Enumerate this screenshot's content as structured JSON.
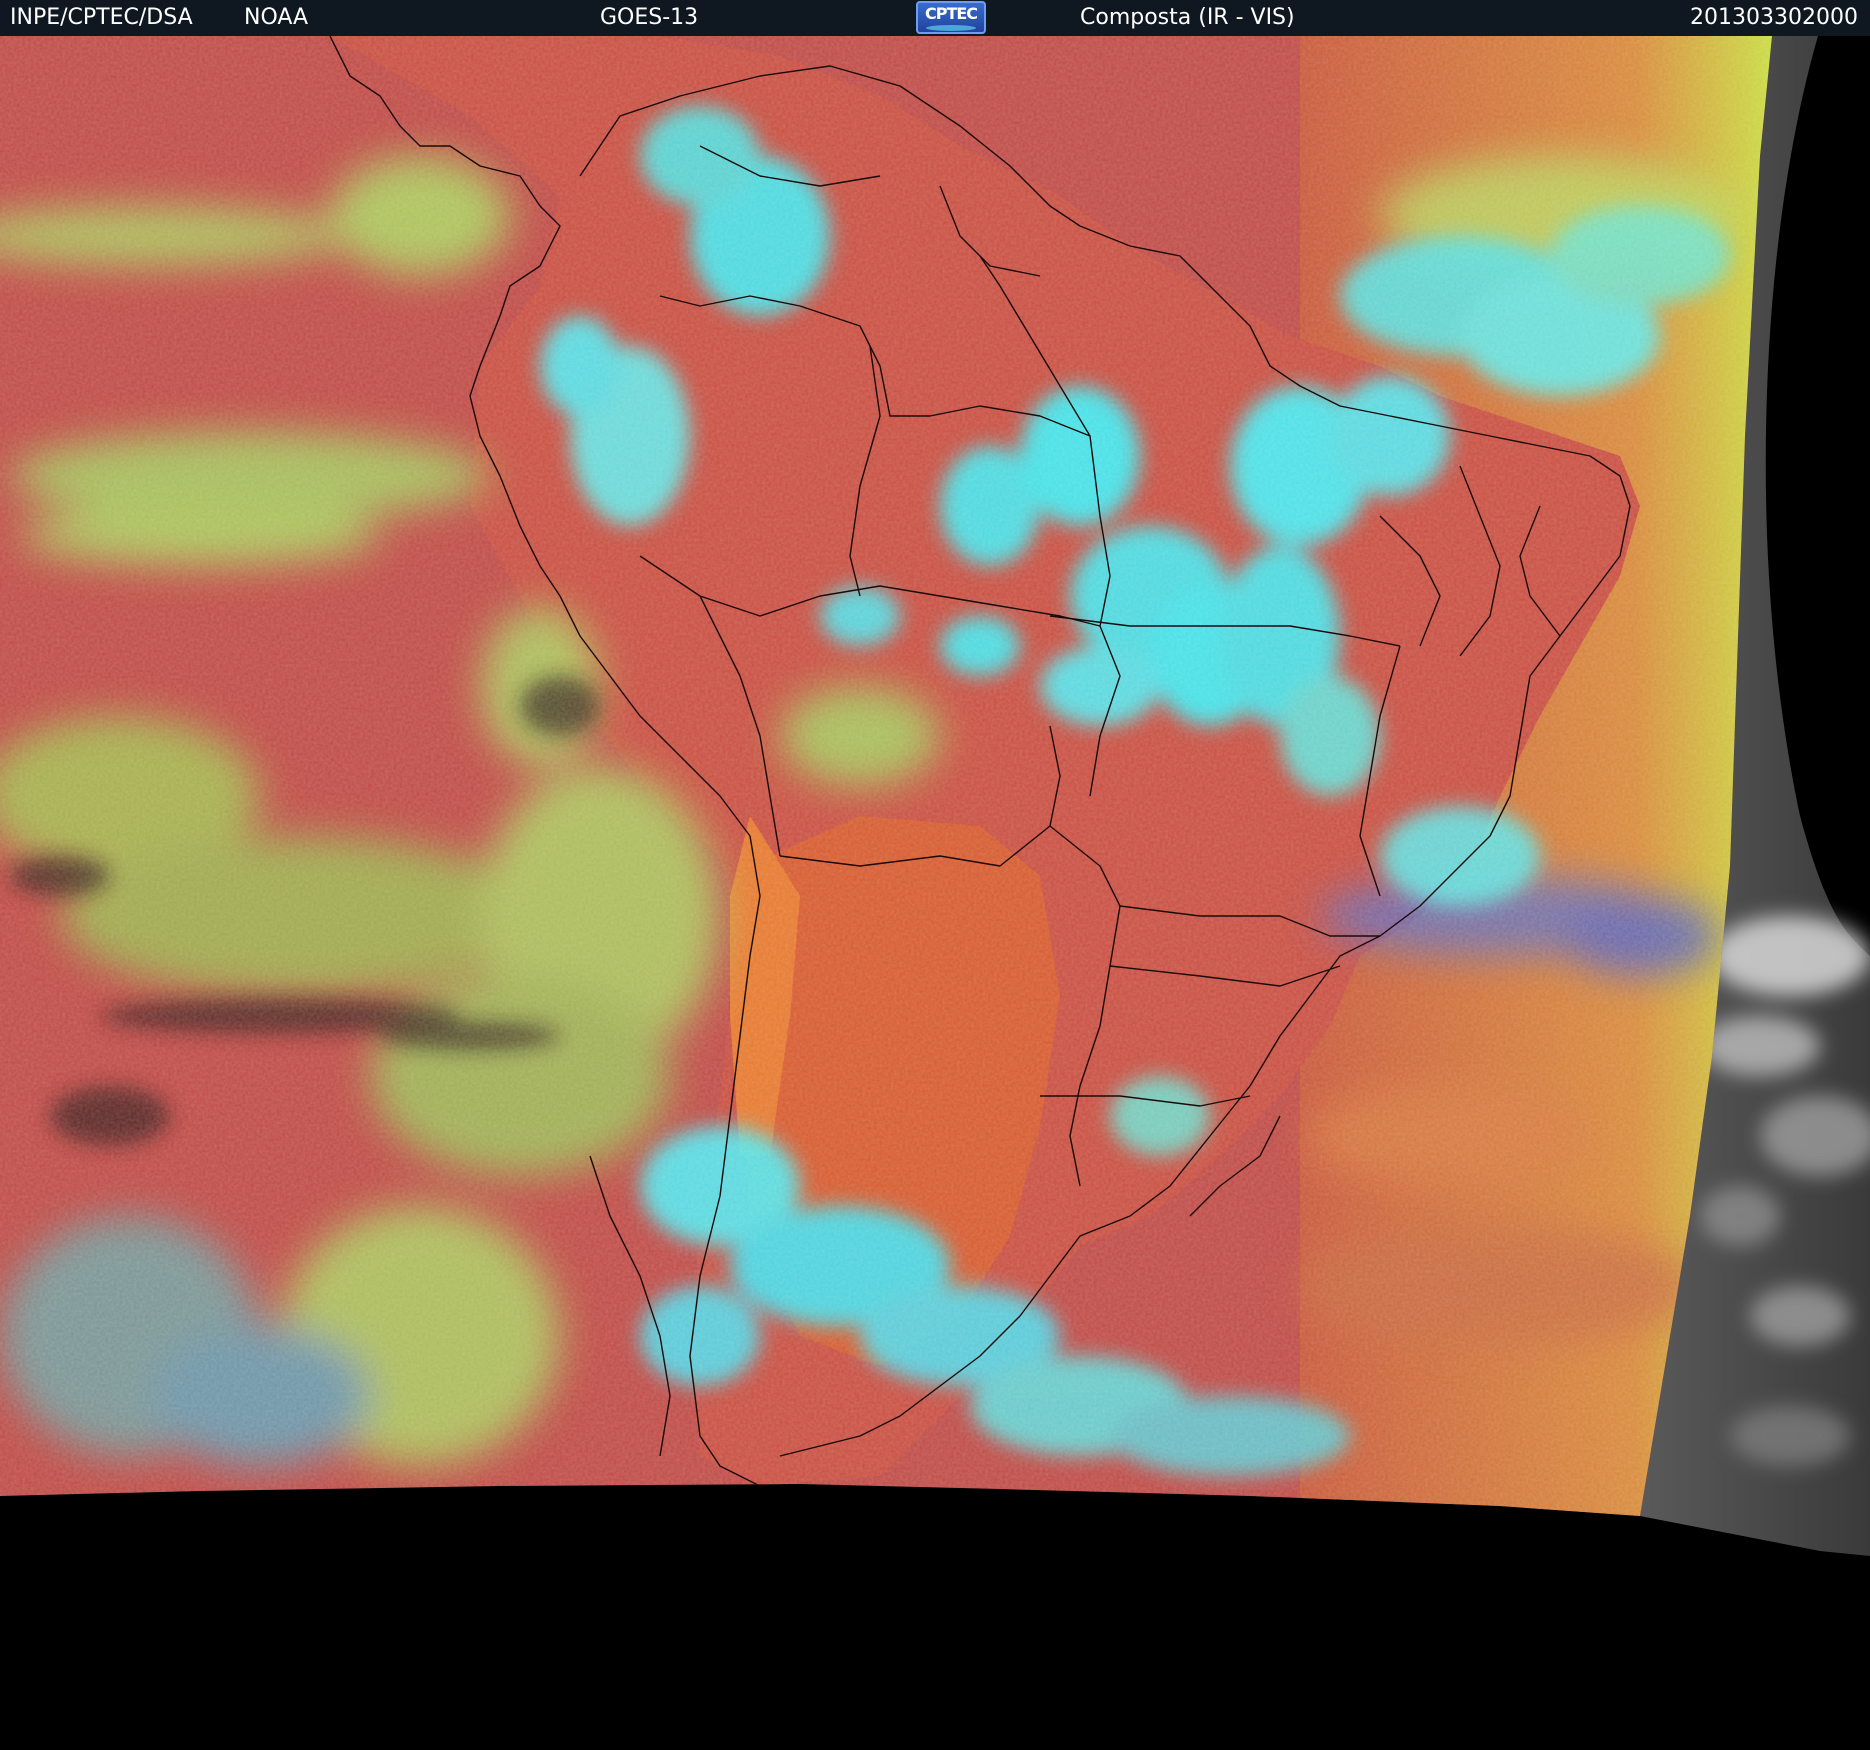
{
  "header": {
    "org": "INPE/CPTEC/DSA",
    "agency": "NOAA",
    "satellite": "GOES-13",
    "logo_text": "CPTEC",
    "product": "Composta (IR - VIS)",
    "timestamp": "201303302000"
  },
  "legend_colors": {
    "clear_surface": "#c04a40",
    "land_warm": "#d8582e",
    "low_cloud": "#a8e060",
    "high_cloud": "#30f0f0",
    "outside_disk": "#000000",
    "vis_only": "#707070"
  },
  "icons": [
    "cptec-logo"
  ]
}
